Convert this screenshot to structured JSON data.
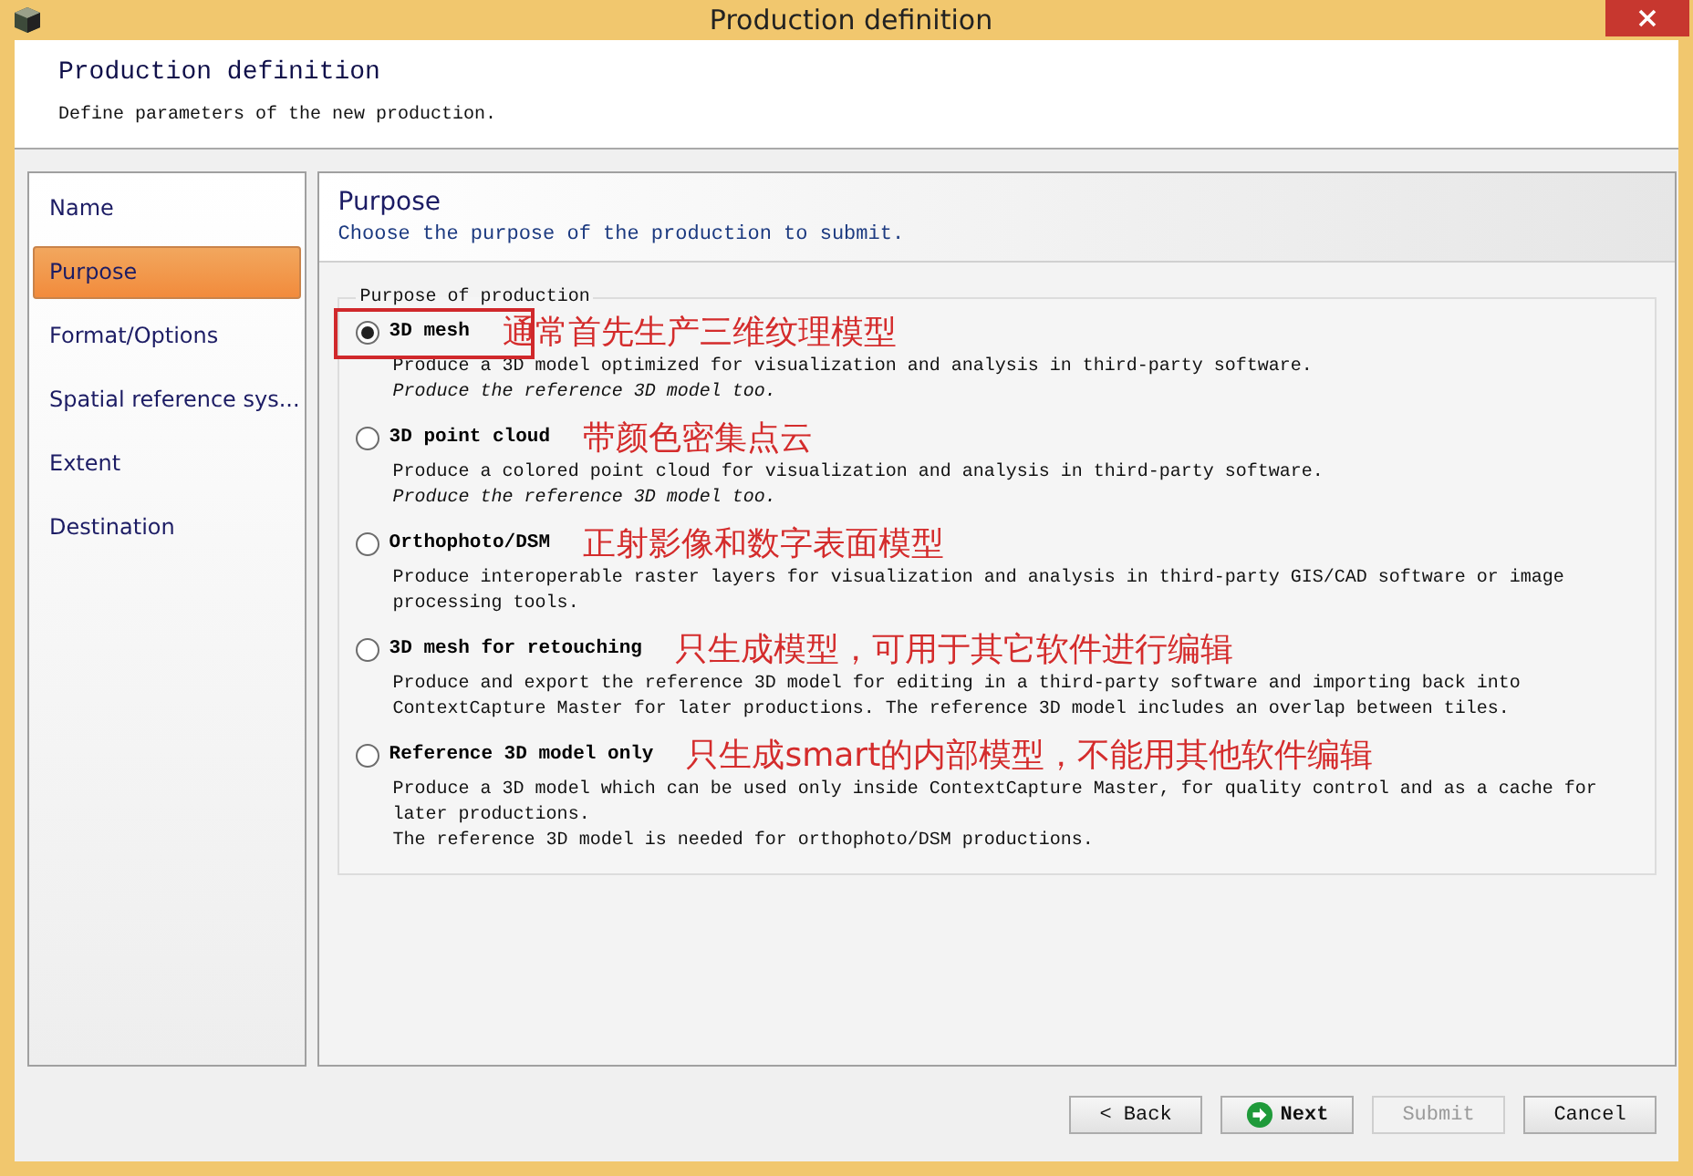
{
  "window": {
    "title": "Production definition"
  },
  "header": {
    "title": "Production definition",
    "subtitle": "Define parameters of the new production."
  },
  "sidebar": {
    "items": [
      {
        "label": "Name",
        "selected": false
      },
      {
        "label": "Purpose",
        "selected": true
      },
      {
        "label": "Format/Options",
        "selected": false
      },
      {
        "label": "Spatial reference sys...",
        "selected": false
      },
      {
        "label": "Extent",
        "selected": false
      },
      {
        "label": "Destination",
        "selected": false
      }
    ]
  },
  "panel": {
    "title": "Purpose",
    "subtitle": "Choose the purpose of the production to submit.",
    "group_title": "Purpose of production",
    "options": [
      {
        "label": "3D mesh",
        "selected": true,
        "highlighted": true,
        "annotation": "通常首先生产三维纹理模型",
        "paragraphs": [
          {
            "text": "Produce a 3D model optimized for visualization and analysis in third-party software.",
            "italic": false
          },
          {
            "text": "Produce the reference 3D model too.",
            "italic": true
          }
        ]
      },
      {
        "label": "3D point cloud",
        "selected": false,
        "highlighted": false,
        "annotation": "带颜色密集点云",
        "paragraphs": [
          {
            "text": "Produce a colored point cloud for visualization and analysis in third-party software.",
            "italic": false
          },
          {
            "text": "Produce the reference 3D model too.",
            "italic": true
          }
        ]
      },
      {
        "label": "Orthophoto/DSM",
        "selected": false,
        "highlighted": false,
        "annotation": "正射影像和数字表面模型",
        "paragraphs": [
          {
            "text": "Produce interoperable raster layers for visualization and analysis in third-party GIS/CAD software or image processing tools.",
            "italic": false
          }
        ]
      },
      {
        "label": "3D mesh for retouching",
        "selected": false,
        "highlighted": false,
        "annotation": "只生成模型，可用于其它软件进行编辑",
        "paragraphs": [
          {
            "text": "Produce and export the reference 3D model for editing in a third-party software and importing back into ContextCapture Master for later productions. The reference 3D model includes an overlap between tiles.",
            "italic": false
          }
        ]
      },
      {
        "label": "Reference 3D model only",
        "selected": false,
        "highlighted": false,
        "annotation": "只生成smart的内部模型，不能用其他软件编辑",
        "paragraphs": [
          {
            "text": "Produce a 3D model which can be used only inside ContextCapture Master, for quality control and as a cache for later productions.",
            "italic": false
          },
          {
            "text": "The reference 3D model is needed for orthophoto/DSM productions.",
            "italic": false
          }
        ]
      }
    ]
  },
  "buttons": [
    {
      "label": "< Back",
      "kind": "back",
      "disabled": false
    },
    {
      "label": "Next",
      "kind": "next",
      "disabled": false
    },
    {
      "label": "Submit",
      "kind": "plain",
      "disabled": true
    },
    {
      "label": "Cancel",
      "kind": "plain",
      "disabled": false
    }
  ]
}
